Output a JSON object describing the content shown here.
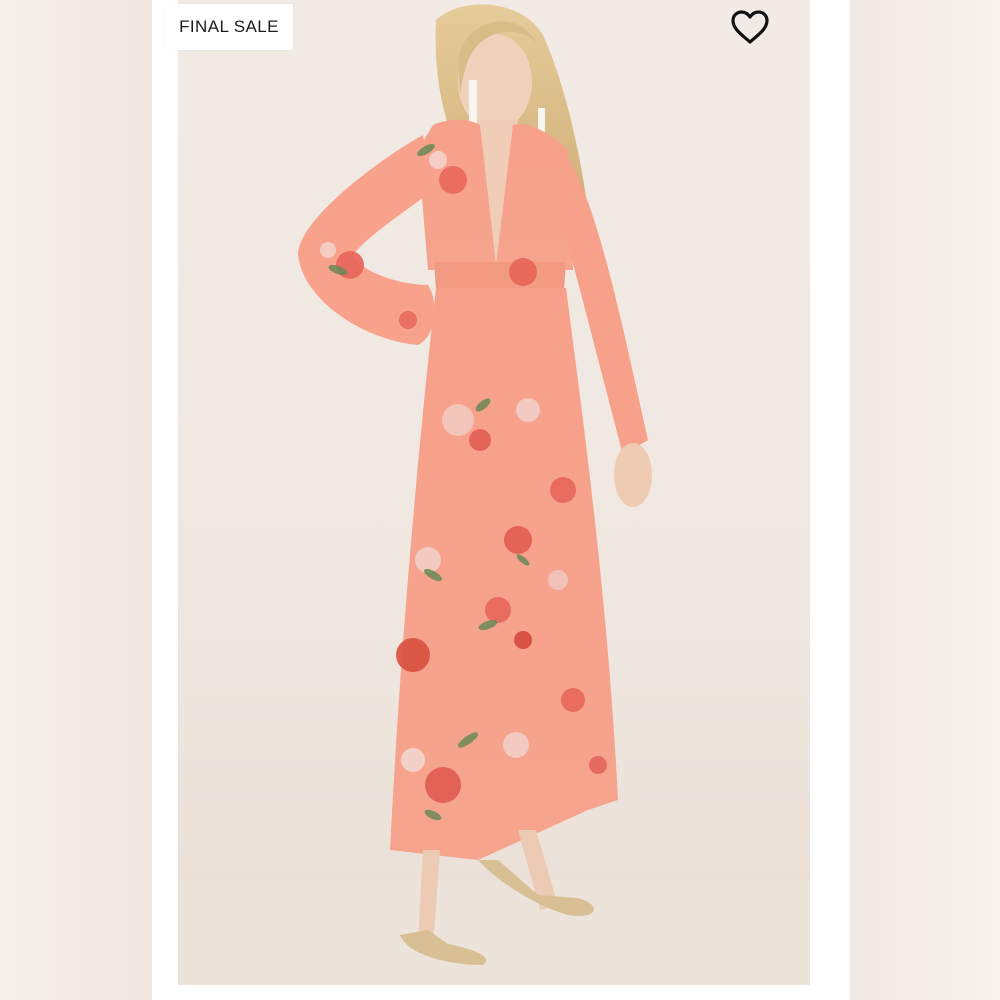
{
  "badge": {
    "label": "FINAL SALE"
  },
  "favorite": {
    "icon": "heart-outline-icon"
  },
  "photo": {
    "subject": "model-in-floral-maxi-dress"
  },
  "colors": {
    "dress": "#f7a38c",
    "background": "#f2ebe5",
    "badge_text": "#1b1b1b"
  }
}
